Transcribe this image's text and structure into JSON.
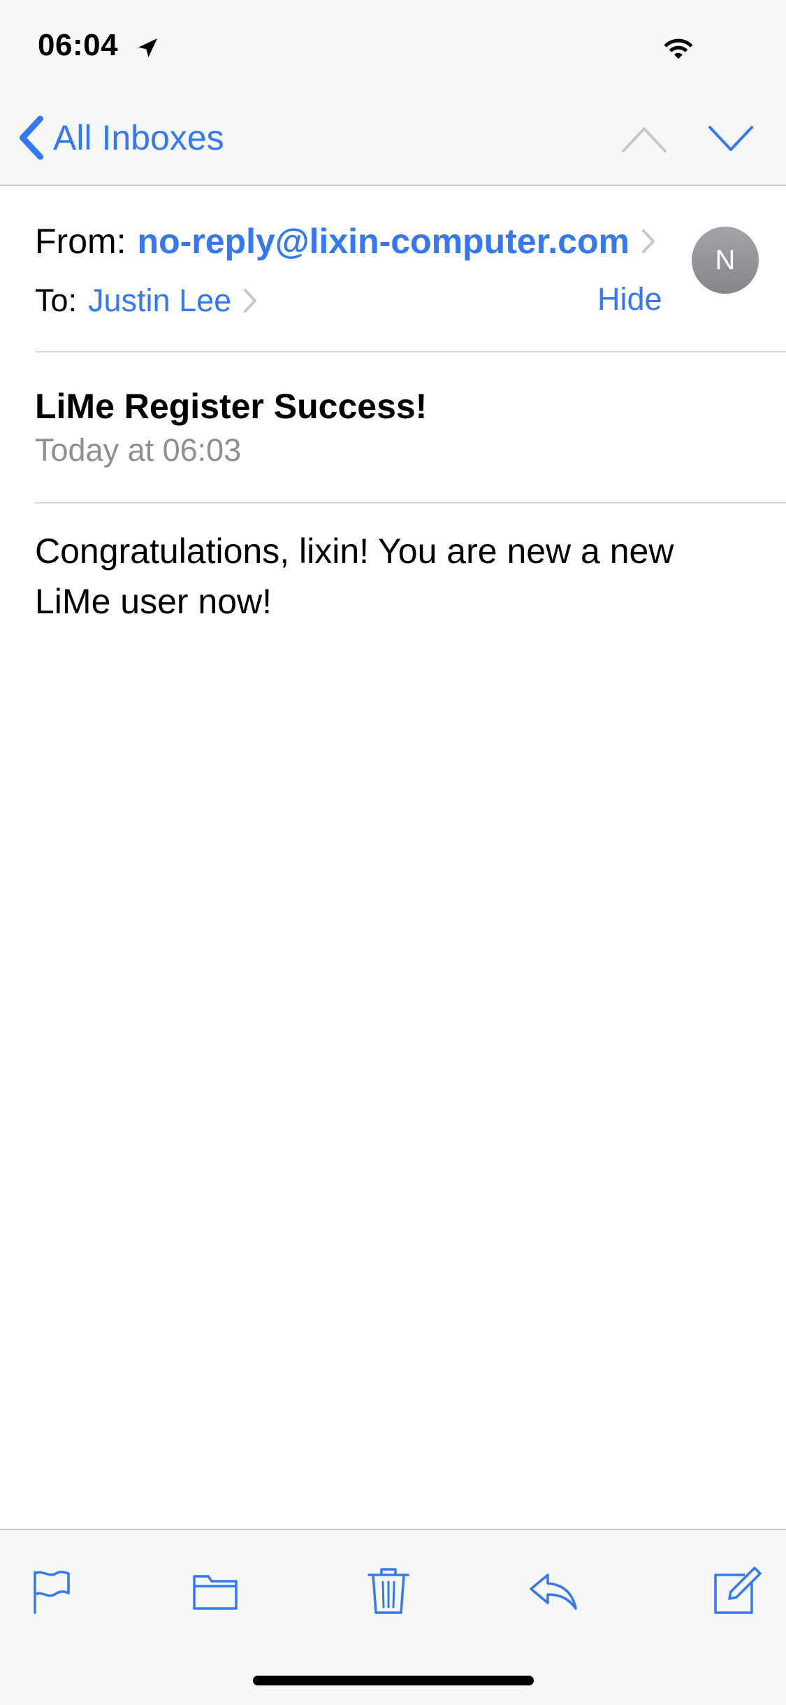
{
  "status_bar": {
    "time": "06:04",
    "location_icon": "location-arrow-icon",
    "wifi_icon": "wifi-icon"
  },
  "nav": {
    "back_label": "All Inboxes",
    "prev_icon": "chevron-up-icon",
    "next_icon": "chevron-down-icon"
  },
  "header": {
    "from_label": "From:",
    "from_value": "no-reply@lixin-computer.com",
    "to_label": "To:",
    "to_value": "Justin Lee",
    "hide_label": "Hide",
    "avatar_initial": "N"
  },
  "message": {
    "subject": "LiMe Register Success!",
    "date": "Today at 06:03",
    "body": "Congratulations, lixin! You are new a new LiMe user now!"
  },
  "toolbar": {
    "items": [
      {
        "icon": "flag-icon"
      },
      {
        "icon": "folder-icon"
      },
      {
        "icon": "trash-icon"
      },
      {
        "icon": "reply-icon"
      },
      {
        "icon": "compose-icon"
      }
    ]
  },
  "colors": {
    "accent": "#3478f6",
    "secondary_text": "#8e8e93",
    "bar_background": "#f7f7f7",
    "disabled": "#c7c7cc"
  }
}
